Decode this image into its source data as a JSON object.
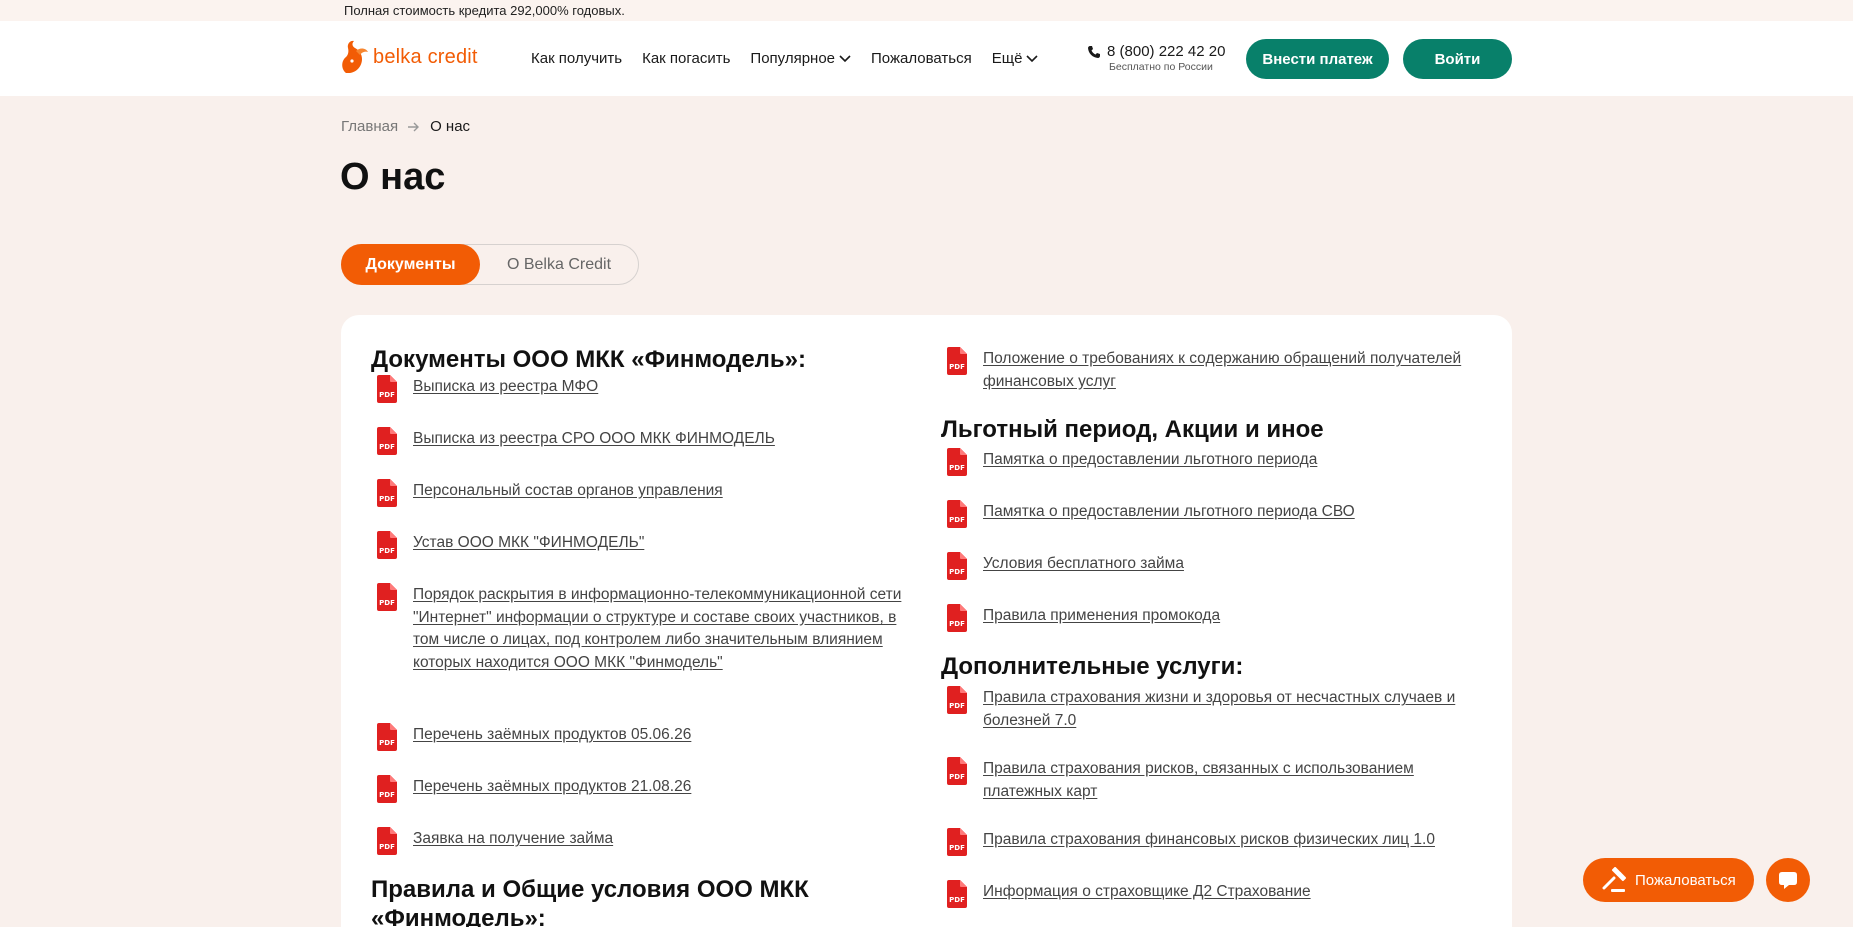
{
  "topbar": {
    "text": "Полная стоимость кредита 292,000% годовых."
  },
  "header": {
    "logo_text": "belka credit",
    "nav": [
      "Как получить",
      "Как погасить",
      "Популярное",
      "Пожаловаться",
      "Ещё"
    ],
    "phone": "8 (800) 222 42 20",
    "phone_note": "Бесплатно по России",
    "pay_button": "Внести платеж",
    "login_button": "Войти"
  },
  "breadcrumb": {
    "home": "Главная",
    "current": "О нас"
  },
  "page_title": "О нас",
  "tabs": {
    "documents": "Документы",
    "about": "О Belka Credit"
  },
  "left_column": {
    "section1_title": "Документы ООО МКК «Финмодель»:",
    "section1_docs": [
      "Выписка из реестра МФО",
      "Выписка из реестра СРО ООО МКК ФИНМОДЕЛЬ",
      "Персональный состав органов управления",
      "Устав ООО МКК \"ФИНМОДЕЛЬ\"",
      "Порядок раскрытия в информационно-телекоммуникационной сети \"Интернет\" информации о структуре и составе своих участников, в том числе о лицах, под контролем либо значительным влиянием которых находится ООО МКК \"Финмодель\"",
      "Перечень заёмных продуктов 05.06.26",
      "Перечень заёмных продуктов 21.08.26",
      "Заявка на получение займа"
    ],
    "section2_title": "Правила и Общие условия ООО МКК «Финмодель»:"
  },
  "right_column": {
    "top_doc": "Положение о требованиях к содержанию обращений получателей финансовых услуг",
    "section1_title": "Льготный период, Акции и иное",
    "section1_docs": [
      "Памятка о предоставлении льготного периода",
      "Памятка о предоставлении льготного периода СВО",
      "Условия бесплатного займа",
      "Правила применения промокода"
    ],
    "section2_title": "Дополнительные услуги:",
    "section2_docs": [
      "Правила страхования жизни и здоровья от несчастных случаев и болезней 7.0",
      "Правила страхования рисков, связанных с использованием платежных карт",
      "Правила страхования финансовых рисков физических лиц 1.0",
      "Информация о страховщике Д2 Страхование"
    ]
  },
  "floating": {
    "complain": "Пожаловаться"
  },
  "colors": {
    "brand_orange": "#f25c05",
    "brand_green": "#08806a",
    "pdf_red": "#e02020"
  },
  "icons": [
    "squirrel-logo-icon",
    "chevron-down-icon",
    "phone-icon",
    "arrow-right-icon",
    "pdf-icon",
    "gavel-icon",
    "chat-icon"
  ]
}
